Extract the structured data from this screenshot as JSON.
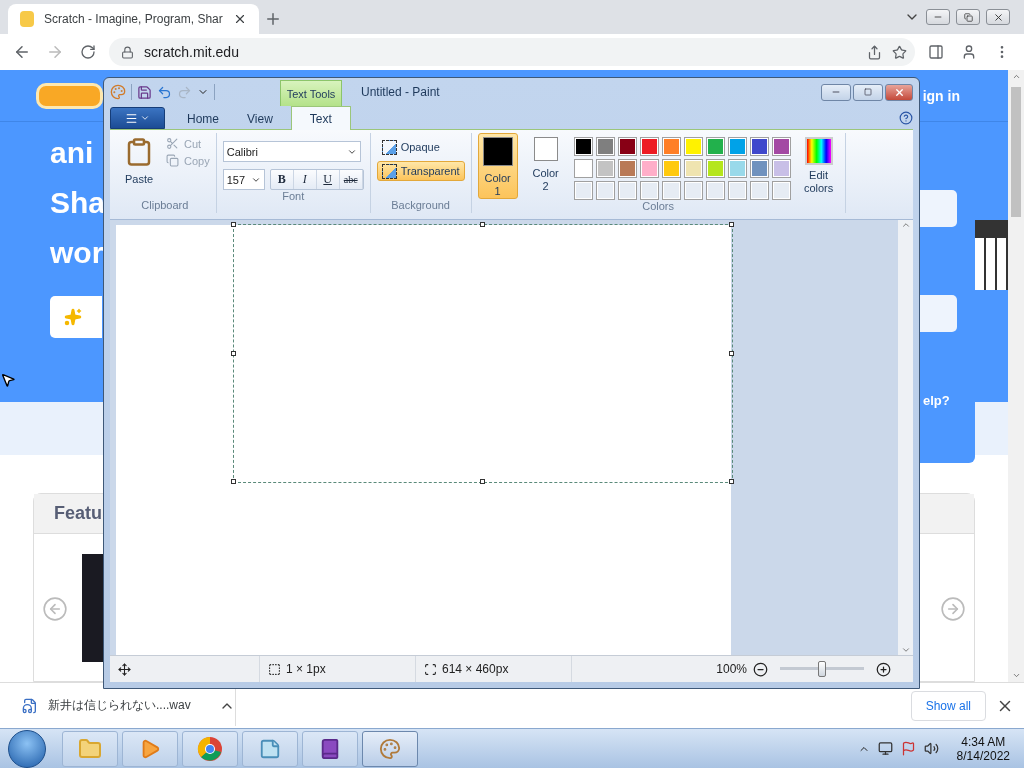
{
  "browser": {
    "tab": {
      "title": "Scratch - Imagine, Program, Shar"
    },
    "address": "scratch.mit.edu"
  },
  "page": {
    "nav_link": "ign in",
    "hero_lines": [
      "ani",
      "Sha",
      "wor"
    ],
    "help_text": "elp?",
    "featured_title": "Featu"
  },
  "paint": {
    "contextual_tab": "Text Tools",
    "title": "Untitled - Paint",
    "tabs": [
      {
        "label": "Home",
        "selected": false
      },
      {
        "label": "View",
        "selected": false
      },
      {
        "label": "Text",
        "selected": true
      }
    ],
    "clipboard": {
      "paste": "Paste",
      "cut": {
        "label": "Cut",
        "disabled": true
      },
      "copy": {
        "label": "Copy",
        "disabled": true
      },
      "group": "Clipboard"
    },
    "font": {
      "family": "Calibri",
      "size": "157",
      "styles": [
        {
          "kind": "bold",
          "label": "B"
        },
        {
          "kind": "italic",
          "label": "I"
        },
        {
          "kind": "underline",
          "label": "U"
        },
        {
          "kind": "strike",
          "label": "abc"
        }
      ],
      "group": "Font"
    },
    "background": {
      "options": [
        {
          "label": "Opaque",
          "selected": false
        },
        {
          "label": "Transparent",
          "selected": true
        }
      ],
      "group": "Background"
    },
    "colors": {
      "slots": [
        {
          "label": "Color 1",
          "color": "#000000",
          "selected": true
        },
        {
          "label": "Color 2",
          "color": "#ffffff",
          "selected": false
        }
      ],
      "palette": [
        {
          "color": "#000000"
        },
        {
          "color": "#7f7f7f"
        },
        {
          "color": "#880015"
        },
        {
          "color": "#ed1c24"
        },
        {
          "color": "#ff7f27"
        },
        {
          "color": "#fff200"
        },
        {
          "color": "#22b14c"
        },
        {
          "color": "#00a2e8"
        },
        {
          "color": "#3f48cc"
        },
        {
          "color": "#a349a4"
        },
        {
          "color": "#ffffff"
        },
        {
          "color": "#c3c3c3"
        },
        {
          "color": "#b97a57"
        },
        {
          "color": "#ffaec9"
        },
        {
          "color": "#ffc90e"
        },
        {
          "color": "#efe4b0"
        },
        {
          "color": "#b5e61d"
        },
        {
          "color": "#99d9ea"
        },
        {
          "color": "#7092be"
        },
        {
          "color": "#c8bfe7"
        }
      ],
      "edit": "Edit colors",
      "group": "Colors"
    },
    "status": {
      "selection": "1 × 1px",
      "size": "614 × 460px",
      "zoom": "100%",
      "zoom_slider": {
        "level": 0.5
      }
    }
  },
  "download": {
    "file": "新井は信じられない....wav",
    "show_all": "Show all"
  },
  "taskbar": {
    "time": "4:34 AM",
    "date": "8/14/2022"
  }
}
